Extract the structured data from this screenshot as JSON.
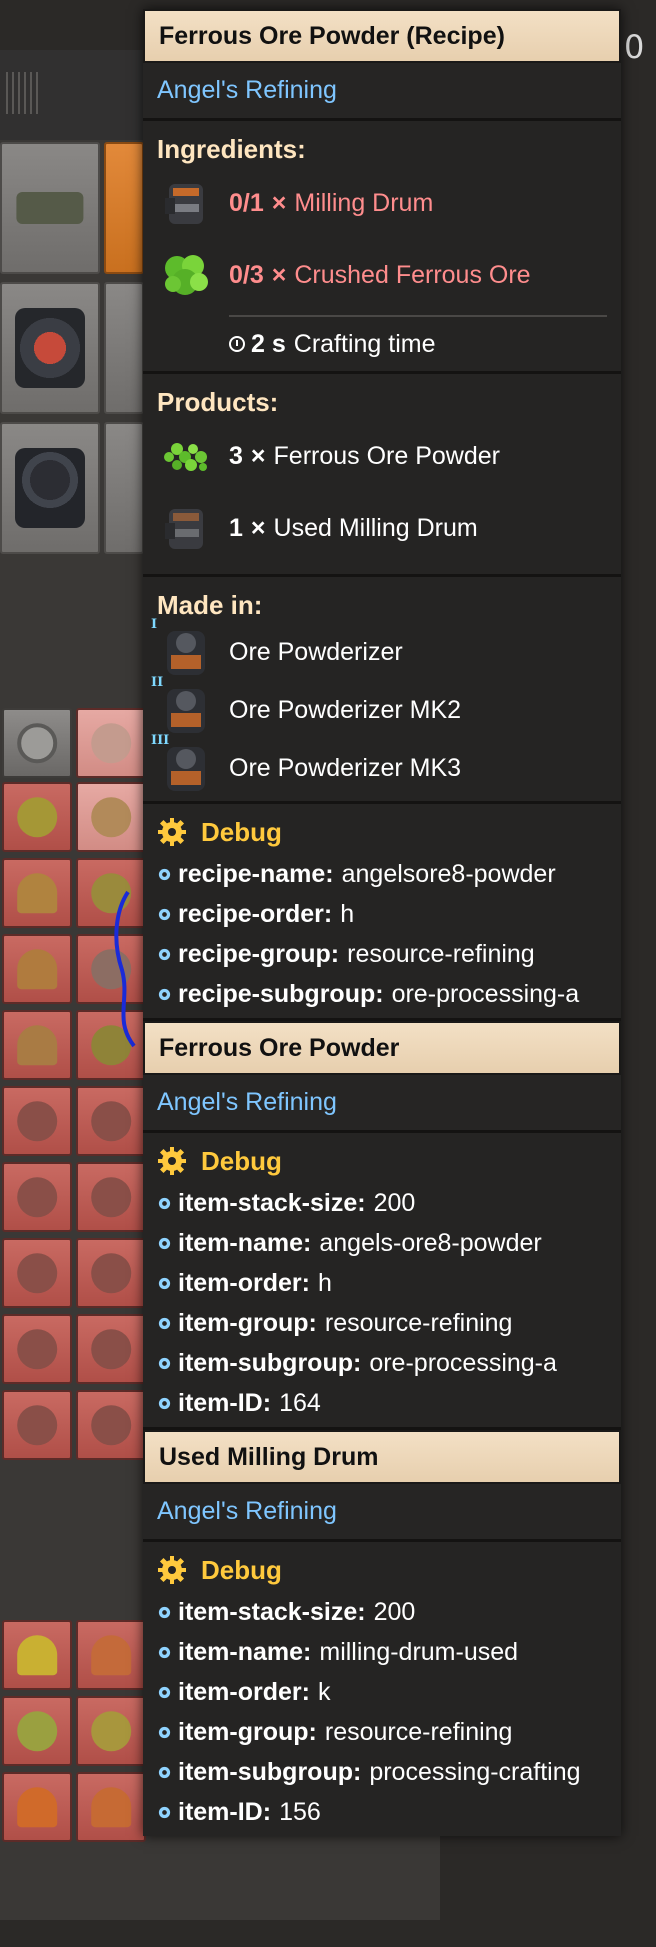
{
  "background": {
    "counter_text": "0"
  },
  "recipe": {
    "title": "Ferrous Ore Powder (Recipe)",
    "mod": "Angel's Refining",
    "ingredients_heading": "Ingredients:",
    "ingredients": [
      {
        "count": "0/1",
        "times": "×",
        "name": "Milling Drum",
        "icon": "milling-drum-icon"
      },
      {
        "count": "0/3",
        "times": "×",
        "name": "Crushed Ferrous Ore",
        "icon": "crushed-ferrous-ore-icon"
      }
    ],
    "crafting_time": {
      "value": "2 s",
      "label": "Crafting time"
    },
    "products_heading": "Products:",
    "products": [
      {
        "count": "3",
        "times": "×",
        "name": "Ferrous Ore Powder",
        "icon": "ferrous-ore-powder-icon"
      },
      {
        "count": "1",
        "times": "×",
        "name": "Used Milling Drum",
        "icon": "used-milling-drum-icon"
      }
    ],
    "made_in_heading": "Made in:",
    "made_in": [
      {
        "tier": "I",
        "name": "Ore Powderizer"
      },
      {
        "tier": "II",
        "name": "Ore Powderizer MK2"
      },
      {
        "tier": "III",
        "name": "Ore Powderizer MK3"
      }
    ],
    "debug": {
      "heading": "Debug",
      "lines": [
        {
          "key": "recipe-name:",
          "value": "angelsore8-powder"
        },
        {
          "key": "recipe-order:",
          "value": "h"
        },
        {
          "key": "recipe-group:",
          "value": "resource-refining"
        },
        {
          "key": "recipe-subgroup:",
          "value": "ore-processing-a"
        }
      ]
    }
  },
  "item1": {
    "title": "Ferrous Ore Powder",
    "mod": "Angel's Refining",
    "debug": {
      "heading": "Debug",
      "lines": [
        {
          "key": "item-stack-size:",
          "value": "200"
        },
        {
          "key": "item-name:",
          "value": "angels-ore8-powder"
        },
        {
          "key": "item-order:",
          "value": "h"
        },
        {
          "key": "item-group:",
          "value": "resource-refining"
        },
        {
          "key": "item-subgroup:",
          "value": "ore-processing-a"
        },
        {
          "key": "item-ID:",
          "value": "164"
        }
      ]
    }
  },
  "item2": {
    "title": "Used Milling Drum",
    "mod": "Angel's Refining",
    "debug": {
      "heading": "Debug",
      "lines": [
        {
          "key": "item-stack-size:",
          "value": "200"
        },
        {
          "key": "item-name:",
          "value": "milling-drum-used"
        },
        {
          "key": "item-order:",
          "value": "k"
        },
        {
          "key": "item-group:",
          "value": "resource-refining"
        },
        {
          "key": "item-subgroup:",
          "value": "processing-crafting"
        },
        {
          "key": "item-ID:",
          "value": "156"
        }
      ]
    }
  },
  "colors": {
    "title_bg": "#f3e0c5",
    "mod_text": "#7fc6ff",
    "missing_text": "#ff8d8d",
    "debug_heading": "#ffc93d",
    "section_heading": "#ffe6c0"
  }
}
